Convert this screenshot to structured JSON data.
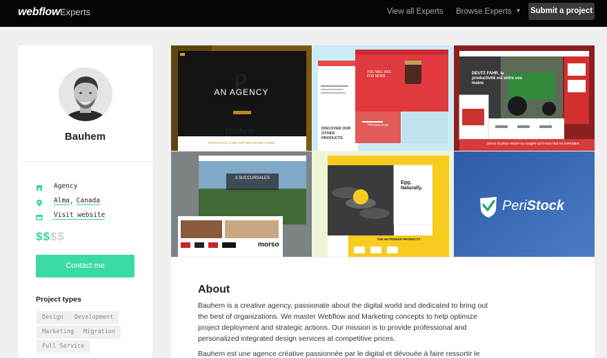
{
  "header": {
    "logo": "webflow",
    "logo_sub": "Experts",
    "nav_view_all": "View all Experts",
    "nav_browse": "Browse Experts",
    "submit_label": "Submit a project"
  },
  "profile": {
    "name": "Bauhem",
    "type": "Agency",
    "city": "Alma",
    "country": "Canada",
    "location_sep": ",",
    "website_label": "Visit website",
    "price_on": "$$",
    "price_off": "$$",
    "contact_label": "Contact me",
    "project_types_title": "Project types",
    "project_types": [
      "Design",
      "Development",
      "Marketing",
      "Migration",
      "Full Service"
    ]
  },
  "gallery": {
    "tile1": {
      "headline": "AN AGENCY",
      "caption": "Achieve your Goals with spectacular results"
    },
    "tile2": {
      "promo": "YOU WILL ASK FOR MORE",
      "discover": "DISCOVER OUR OTHER PRODUCTS",
      "production": "PRODUCTION"
    },
    "tile3": {
      "headline": "DEUTZ FAHR, la productivité est entre vos mains",
      "banner": "avons la pièce neuve ou usagée qu'il vous faut en inventaire."
    },
    "tile4": {
      "headline": "3 SUCCURSALES",
      "brand": "morso"
    },
    "tile5": {
      "headline": "Egg, Naturally.",
      "products": "THE NUTRIDEEP PRODUCTS"
    },
    "tile6": {
      "brand_a": "Peri",
      "brand_b": "Stock"
    }
  },
  "about": {
    "title": "About",
    "p1": "Bauhem is a creative agency, passionate about the digital world and dedicated to bring out the best of organizations. We master Webflow and Marketing concepts to help optimize project deployment and strategic actions. Our mission is to provide professional and personalized integrated design services at competitive prices.",
    "p2": "Bauhem est une agence créative passionnée par le digital et dévouée à faire ressortir le"
  },
  "colors": {
    "accent": "#3bdba3",
    "topbar": "#050505",
    "peristock_blue": "#3263ad"
  }
}
